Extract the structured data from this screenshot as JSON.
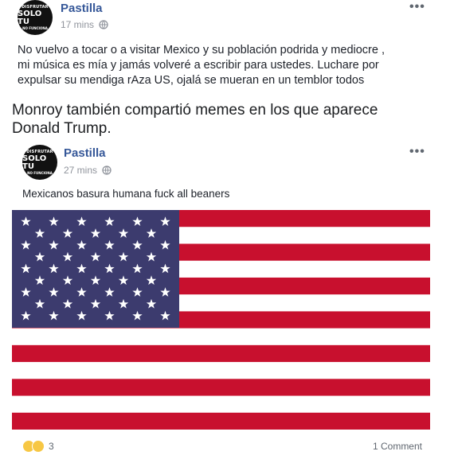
{
  "post1": {
    "avatar": {
      "top": "DISFRUTAR",
      "main": "SOLO TU",
      "bottom": "NO FUNCIONA"
    },
    "author": "Pastilla",
    "time": "17 mins",
    "more": "•••",
    "text_lines": [
      "No vuelvo a tocar o a visitar Mexico y su población podrida y mediocre ,",
      "mi música es mía y jamás volveré a escribir para ustedes. Luchare por",
      "expulsar su mendiga rAza US, ojalá se mueran en un temblor todos"
    ]
  },
  "article": {
    "caption_lines": [
      "Monroy también compartió memes en los que aparece",
      "Donald Trump."
    ]
  },
  "post2": {
    "avatar": {
      "top": "DISFRUTAR",
      "main": "SOLO TU",
      "bottom": "NO FUNCIONA"
    },
    "author": "Pastilla",
    "time": "27 mins",
    "more": "•••",
    "text": "Mexicanos basura humana fuck all beaners",
    "reactions_count": "3",
    "comments": "1 Comment"
  },
  "colors": {
    "flag_red": "#c8102e",
    "flag_blue": "#3c3b6e",
    "link": "#365899"
  }
}
